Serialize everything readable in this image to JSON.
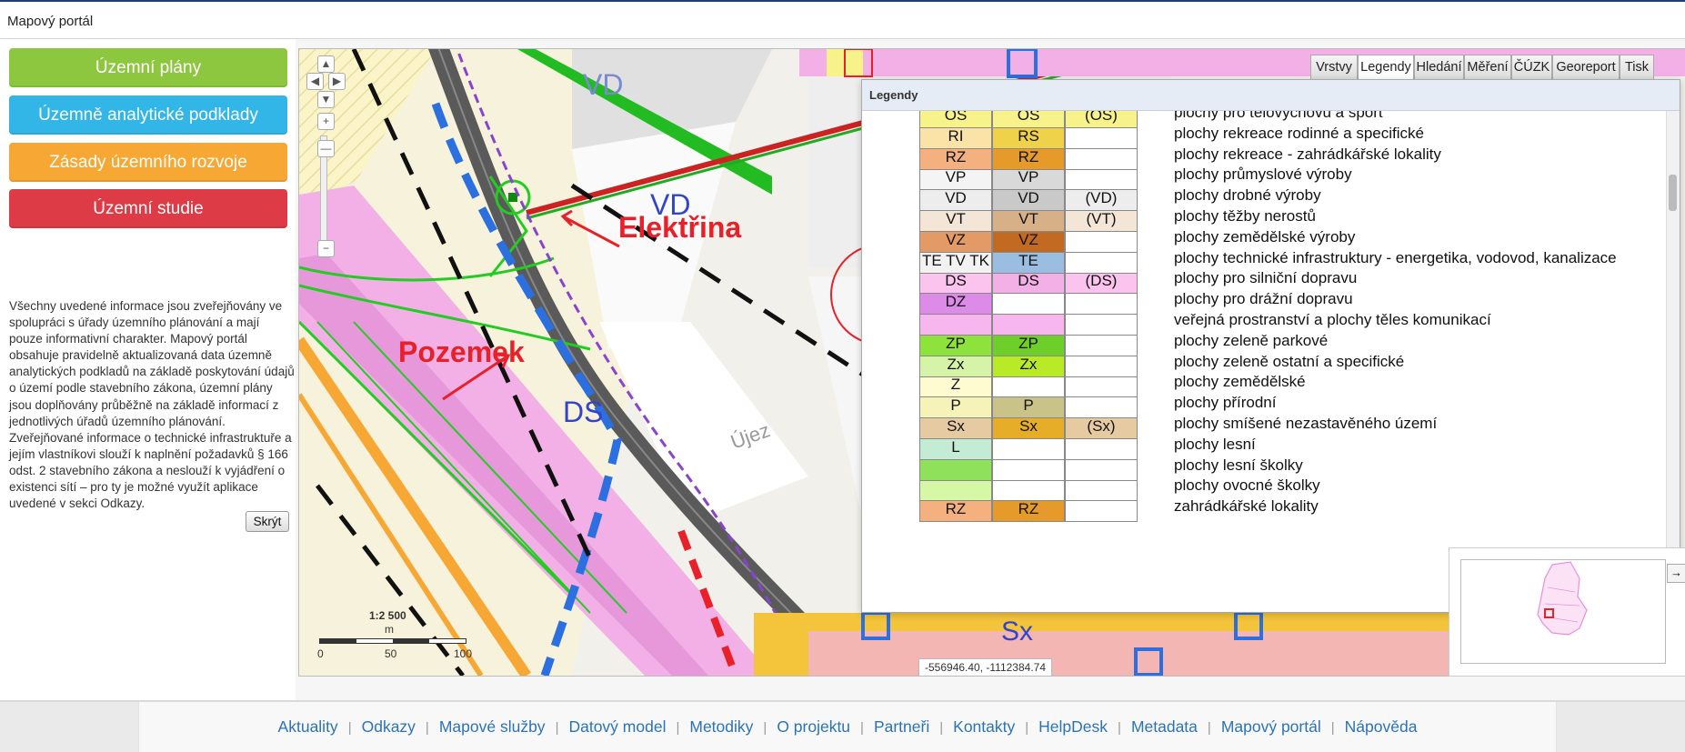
{
  "header": {
    "title": "Mapový portál"
  },
  "nav": {
    "buttons": [
      {
        "label": "Územní plány",
        "color": "#8dc63f"
      },
      {
        "label": "Územně analytické podklady",
        "color": "#32b6e8"
      },
      {
        "label": "Zásady územního rozvoje",
        "color": "#f7a733"
      },
      {
        "label": "Územní studie",
        "color": "#dd3b45"
      }
    ]
  },
  "info": {
    "text": "Všechny uvedené informace jsou zveřejňovány ve spolupráci s úřady územního plánování a mají pouze informativní charakter. Mapový portál obsahuje pravidelně aktualizovaná data územně analytických podkladů na základě poskytování údajů o území podle stavebního zákona, územní plány jsou doplňovány průběžně na základě informací z jednotlivých úřadů územního plánování. Zveřejňované informace o technické infrastruktuře a jejím vlastníkovi slouží k naplnění požadavků § 166 odst. 2 stavebního zákona a neslouží k vyjádření o existenci sítí – pro ty je možné využít aplikace uvedené v sekci Odkazy.",
    "hide_label": "Skrýt"
  },
  "map": {
    "tabs": [
      "Vrstvy",
      "Legendy",
      "Hledání",
      "Měření",
      "ČÚZK",
      "Georeport",
      "Tisk"
    ],
    "active_tab": "Legendy",
    "labels": {
      "vd1": "VD",
      "vd2": "VD",
      "ds": "DS",
      "sx": "Sx",
      "uj": "Újez"
    },
    "annotations": {
      "elektrina": "Elektřina",
      "pozemek": "Pozemek"
    },
    "scale": {
      "ratio": "1:2 500",
      "unit": "m",
      "ticks": [
        "0",
        "50",
        "100"
      ]
    },
    "coordinates": "-556946.40, -1112384.74"
  },
  "legend": {
    "title": "Legendy",
    "rows": [
      {
        "code": "OS",
        "code2": "OS",
        "code3": "(OS)",
        "desc": "plochy pro tělovýchovu a sport",
        "c1": "#f8f28a",
        "c2": "#f8f28a"
      },
      {
        "code": "RI",
        "code2": "RS",
        "code3": "",
        "desc": "plochy rekreace rodinné a specifické",
        "c1": "#fbe3a8",
        "c2": "#f0d24a"
      },
      {
        "code": "RZ",
        "code2": "RZ",
        "code3": "",
        "desc": "plochy rekreace - zahrádkářské lokality",
        "c1": "#f4b07e",
        "c2": "#e59a2a"
      },
      {
        "code": "VP",
        "code2": "VP",
        "code3": "",
        "desc": "plochy průmyslové výroby",
        "c1": "#f4f4f4",
        "c2": "#d9d9d9"
      },
      {
        "code": "VD",
        "code2": "VD",
        "code3": "(VD)",
        "desc": "plochy drobné výroby",
        "c1": "#ededed",
        "c2": "#c9c9c9"
      },
      {
        "code": "VT",
        "code2": "VT",
        "code3": "(VT)",
        "desc": "plochy těžby nerostů",
        "c1": "#f3e6d6",
        "c2": "#d8b088"
      },
      {
        "code": "VZ",
        "code2": "VZ",
        "code3": "",
        "desc": "plochy zemědělské výroby",
        "c1": "#e49a64",
        "c2": "#c26a22"
      },
      {
        "code": "TE TV TK",
        "code2": "TE",
        "code3": "",
        "desc": "plochy technické infrastruktury - energetika, vodovod, kanalizace",
        "c1": "#f2f2f2",
        "c2": "#9bbee0"
      },
      {
        "code": "DS",
        "code2": "DS",
        "code3": "(DS)",
        "desc": "plochy pro silniční dopravu",
        "c1": "#fbc4ee",
        "c2": "#f3b0e6"
      },
      {
        "code": "DZ",
        "code2": "",
        "code3": "",
        "desc": "plochy pro drážní dopravu",
        "c1": "#dc8be8",
        "c2": "#ffffff"
      },
      {
        "code": "",
        "code2": "",
        "code3": "",
        "desc": "veřejná prostranství a plochy těles komunikací",
        "c1": "#f8b6ee",
        "c2": "#f8b6ee"
      },
      {
        "code": "ZP",
        "code2": "ZP",
        "code3": "",
        "desc": "plochy zeleně parkové",
        "c1": "#8ee23c",
        "c2": "#6fcf2a"
      },
      {
        "code": "Zx",
        "code2": "Zx",
        "code3": "",
        "desc": "plochy zeleně ostatní a specifické",
        "c1": "#d6f4a8",
        "c2": "#b8ea28"
      },
      {
        "code": "Z",
        "code2": "",
        "code3": "",
        "desc": "plochy zemědělské",
        "c1": "#fffbd0",
        "c2": "#ffffff"
      },
      {
        "code": "P",
        "code2": "P",
        "code3": "",
        "desc": "plochy přírodní",
        "c1": "#f6f3b8",
        "c2": "#c9c38a"
      },
      {
        "code": "Sx",
        "code2": "Sx",
        "code3": "(Sx)",
        "desc": "plochy smíšené nezastavěného území",
        "c1": "#e6cba2",
        "c2": "#e6ad28"
      },
      {
        "code": "L",
        "code2": "",
        "code3": "",
        "desc": "plochy lesní",
        "c1": "#c4ecd4",
        "c2": "#ffffff"
      },
      {
        "code": "",
        "code2": "",
        "code3": "",
        "desc": "plochy lesní školky",
        "c1": "#8fe05a",
        "c2": "#ffffff"
      },
      {
        "code": "",
        "code2": "",
        "code3": "",
        "desc": "plochy ovocné školky",
        "c1": "#d6f7a6",
        "c2": "#ffffff"
      },
      {
        "code": "RZ",
        "code2": "RZ",
        "code3": "",
        "desc": "zahrádkářské lokality",
        "c1": "#f4b07e",
        "c2": "#e59a2a"
      }
    ]
  },
  "footer": {
    "links": [
      "Aktuality",
      "Odkazy",
      "Mapové služby",
      "Datový model",
      "Metodiky",
      "O projektu",
      "Partneři",
      "Kontakty",
      "HelpDesk",
      "Metadata",
      "Mapový portál",
      "Nápověda"
    ]
  }
}
